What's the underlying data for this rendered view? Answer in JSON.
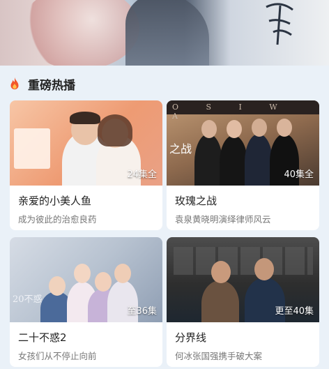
{
  "banner": {
    "calligraphy": ""
  },
  "section": {
    "title": "重磅热播"
  },
  "cards": [
    {
      "title": "亲爱的小美人鱼",
      "subtitle": "成为彼此的治愈良药",
      "count": "24集全"
    },
    {
      "title": "玫瑰之战",
      "subtitle": "袁泉黄晓明演绎律师风云",
      "count": "40集全",
      "poster_text": "之战",
      "poster_letters": "O S I W A"
    },
    {
      "title": "二十不惑2",
      "subtitle": "女孩们从不停止向前",
      "count": "至36集",
      "poster_text": "20不惑"
    },
    {
      "title": "分界线",
      "subtitle": "何冰张国强携手破大案",
      "count": "更至40集"
    }
  ],
  "colors": {
    "page_bg": "#eaf1f8",
    "card_bg": "#ffffff",
    "flame": "#f2562b"
  }
}
